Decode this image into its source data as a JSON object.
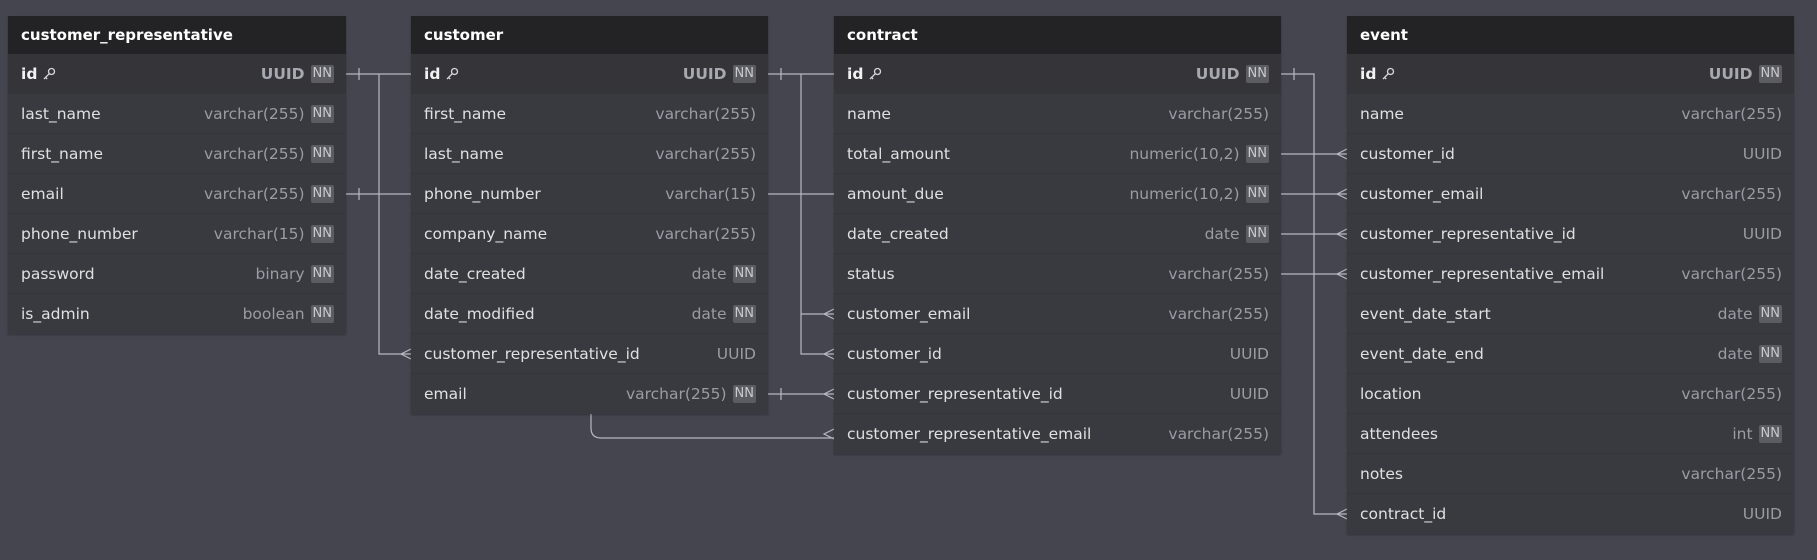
{
  "tables": [
    {
      "name": "customer_representative",
      "columns": [
        {
          "name": "id",
          "type": "UUID",
          "nn": "NN",
          "pk": true
        },
        {
          "name": "last_name",
          "type": "varchar(255)",
          "nn": "NN"
        },
        {
          "name": "first_name",
          "type": "varchar(255)",
          "nn": "NN"
        },
        {
          "name": "email",
          "type": "varchar(255)",
          "nn": "NN"
        },
        {
          "name": "phone_number",
          "type": "varchar(15)",
          "nn": "NN"
        },
        {
          "name": "password",
          "type": "binary",
          "nn": "NN"
        },
        {
          "name": "is_admin",
          "type": "boolean",
          "nn": "NN"
        }
      ]
    },
    {
      "name": "customer",
      "columns": [
        {
          "name": "id",
          "type": "UUID",
          "nn": "NN",
          "pk": true
        },
        {
          "name": "first_name",
          "type": "varchar(255)",
          "nn": ""
        },
        {
          "name": "last_name",
          "type": "varchar(255)",
          "nn": ""
        },
        {
          "name": "phone_number",
          "type": "varchar(15)",
          "nn": ""
        },
        {
          "name": "company_name",
          "type": "varchar(255)",
          "nn": ""
        },
        {
          "name": "date_created",
          "type": "date",
          "nn": "NN"
        },
        {
          "name": "date_modified",
          "type": "date",
          "nn": "NN"
        },
        {
          "name": "customer_representative_id",
          "type": "UUID",
          "nn": ""
        },
        {
          "name": "email",
          "type": "varchar(255)",
          "nn": "NN"
        }
      ]
    },
    {
      "name": "contract",
      "columns": [
        {
          "name": "id",
          "type": "UUID",
          "nn": "NN",
          "pk": true
        },
        {
          "name": "name",
          "type": "varchar(255)",
          "nn": ""
        },
        {
          "name": "total_amount",
          "type": "numeric(10,2)",
          "nn": "NN"
        },
        {
          "name": "amount_due",
          "type": "numeric(10,2)",
          "nn": "NN"
        },
        {
          "name": "date_created",
          "type": "date",
          "nn": "NN"
        },
        {
          "name": "status",
          "type": "varchar(255)",
          "nn": ""
        },
        {
          "name": "customer_email",
          "type": "varchar(255)",
          "nn": ""
        },
        {
          "name": "customer_id",
          "type": "UUID",
          "nn": ""
        },
        {
          "name": "customer_representative_id",
          "type": "UUID",
          "nn": ""
        },
        {
          "name": "customer_representative_email",
          "type": "varchar(255)",
          "nn": ""
        }
      ]
    },
    {
      "name": "event",
      "columns": [
        {
          "name": "id",
          "type": "UUID",
          "nn": "NN",
          "pk": true
        },
        {
          "name": "name",
          "type": "varchar(255)",
          "nn": ""
        },
        {
          "name": "customer_id",
          "type": "UUID",
          "nn": ""
        },
        {
          "name": "customer_email",
          "type": "varchar(255)",
          "nn": ""
        },
        {
          "name": "customer_representative_id",
          "type": "UUID",
          "nn": ""
        },
        {
          "name": "customer_representative_email",
          "type": "varchar(255)",
          "nn": ""
        },
        {
          "name": "event_date_start",
          "type": "date",
          "nn": "NN"
        },
        {
          "name": "event_date_end",
          "type": "date",
          "nn": "NN"
        },
        {
          "name": "location",
          "type": "varchar(255)",
          "nn": ""
        },
        {
          "name": "attendees",
          "type": "int",
          "nn": "NN"
        },
        {
          "name": "notes",
          "type": "varchar(255)",
          "nn": ""
        },
        {
          "name": "contract_id",
          "type": "UUID",
          "nn": ""
        }
      ]
    }
  ],
  "colors": {
    "canvas": "#45454f",
    "table_body": "#393940",
    "table_header": "#232325",
    "connector": "#b8b8c0"
  },
  "icons": {
    "primary_key": "key-icon"
  }
}
